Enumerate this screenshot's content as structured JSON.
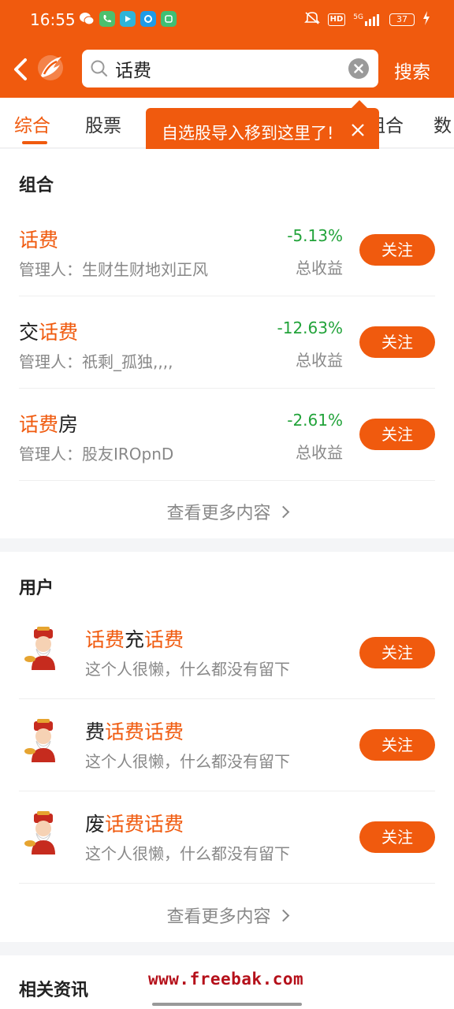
{
  "status_bar": {
    "time": "16:55",
    "hd": "HD",
    "network": "5G",
    "battery": "37"
  },
  "header": {
    "search_query": "话费",
    "search_button": "搜索"
  },
  "tabs": [
    "综合",
    "股票",
    "组合",
    "数"
  ],
  "tooltip": {
    "text": "自选股导入移到这里了!"
  },
  "portfolio_section": {
    "title": "组合",
    "items": [
      {
        "prefix": "",
        "highlight": "话费",
        "suffix": "",
        "manager": "管理人：生财生财地刘正风",
        "return_pct": "-5.13%",
        "return_label": "总收益",
        "follow": "关注"
      },
      {
        "prefix": "交",
        "highlight": "话费",
        "suffix": "",
        "manager": "管理人：祇剩_孤独,,,,",
        "return_pct": "-12.63%",
        "return_label": "总收益",
        "follow": "关注"
      },
      {
        "prefix": "",
        "highlight": "话费",
        "suffix": "房",
        "manager": "管理人：股友IROpnD",
        "return_pct": "-2.61%",
        "return_label": "总收益",
        "follow": "关注"
      }
    ],
    "more": "查看更多内容"
  },
  "user_section": {
    "title": "用户",
    "items": [
      {
        "segments": [
          {
            "t": "话费",
            "hl": true
          },
          {
            "t": "充",
            "hl": false
          },
          {
            "t": "话费",
            "hl": true
          }
        ],
        "bio": "这个人很懒，什么都没有留下",
        "follow": "关注"
      },
      {
        "segments": [
          {
            "t": "费",
            "hl": false
          },
          {
            "t": "话费话费",
            "hl": true
          }
        ],
        "bio": "这个人很懒，什么都没有留下",
        "follow": "关注"
      },
      {
        "segments": [
          {
            "t": "废",
            "hl": false
          },
          {
            "t": "话费话费",
            "hl": true
          }
        ],
        "bio": "这个人很懒，什么都没有留下",
        "follow": "关注"
      }
    ],
    "more": "查看更多内容"
  },
  "news_section": {
    "title": "相关资讯"
  },
  "watermark": "www.freebak.com",
  "colors": {
    "accent": "#f05a0e",
    "negative_return": "#22a33a"
  }
}
